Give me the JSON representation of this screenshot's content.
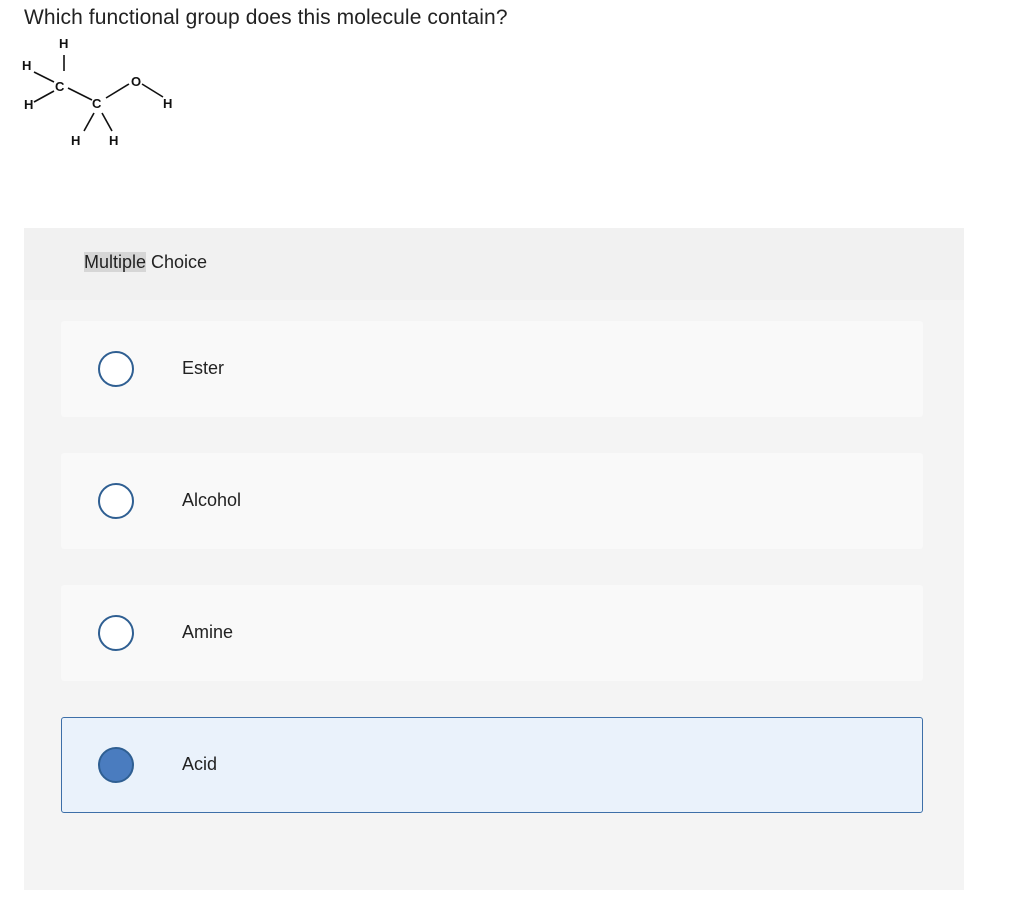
{
  "question": "Which functional group does this molecule contain?",
  "molecule": {
    "atoms": [
      "H",
      "H",
      "C",
      "H",
      "C",
      "O",
      "H",
      "H",
      "H"
    ],
    "bond_glyph": "I"
  },
  "multiple_choice": {
    "label_highlight": "Multiple",
    "label_rest": " Choice"
  },
  "options": [
    {
      "label": "Ester",
      "selected": false
    },
    {
      "label": "Alcohol",
      "selected": false
    },
    {
      "label": "Amine",
      "selected": false
    },
    {
      "label": "Acid",
      "selected": true
    }
  ],
  "colors": {
    "accent": "#4a7cbf",
    "radio_border": "#2f5f92",
    "selected_bg": "#eaf2fb",
    "panel_bg": "#f4f4f4"
  }
}
